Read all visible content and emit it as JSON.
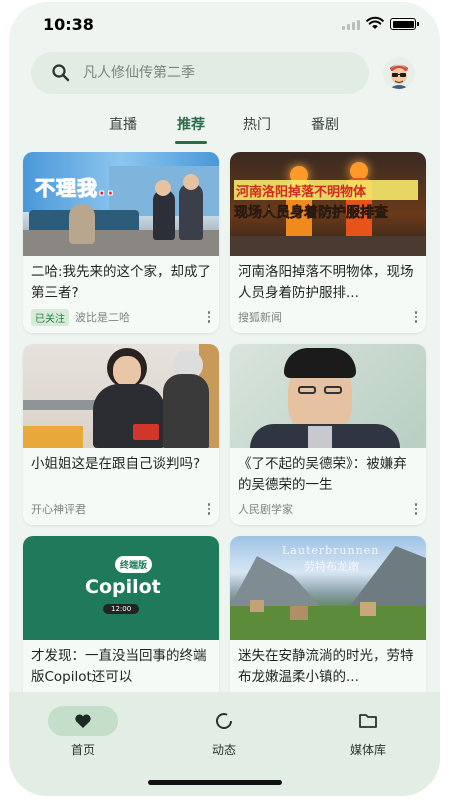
{
  "status_bar": {
    "time": "10:38"
  },
  "search": {
    "placeholder": "凡人修仙传第二季"
  },
  "tabs": [
    {
      "label": "直播"
    },
    {
      "label": "推荐",
      "active": true
    },
    {
      "label": "热门"
    },
    {
      "label": "番剧"
    }
  ],
  "cards": [
    {
      "thumb_text": "不理我..",
      "title": "二哈:我先来的这个家，却成了第三者?",
      "badge": "已关注",
      "author": "波比是二哈"
    },
    {
      "thumb_text_1": "河南洛阳掉落不明物体",
      "thumb_text_2": "现场人员身着防护服排查",
      "title": "河南洛阳掉落不明物体，现场人员身着防护服排...",
      "author": "搜狐新闻"
    },
    {
      "title": "小姐姐这是在跟自己谈判吗?",
      "author": "开心神评君"
    },
    {
      "title": "《了不起的吴德荣》：被嫌弃的吴德荣的一生",
      "author": "人民剧学家"
    },
    {
      "thumb_tag": "终端版",
      "thumb_text": "Copilot",
      "thumb_sub": "12:00",
      "title": "才发现：一直没当回事的终端版Copilot还可以"
    },
    {
      "thumb_text_1": "Lauterbrunnen",
      "thumb_text_2": "劳特布龙嫩",
      "title": "迷失在安静流淌的时光，劳特布龙嫩温柔小镇的..."
    }
  ],
  "bottom_nav": [
    {
      "label": "首页",
      "icon": "heart-icon",
      "active": true
    },
    {
      "label": "动态",
      "icon": "refresh-circle-icon"
    },
    {
      "label": "媒体库",
      "icon": "folder-icon"
    }
  ],
  "colors": {
    "accent": "#2f6b4a",
    "background": "#eef4ef",
    "nav_bg": "#e2ede4",
    "active_pill": "#c4dec9"
  }
}
